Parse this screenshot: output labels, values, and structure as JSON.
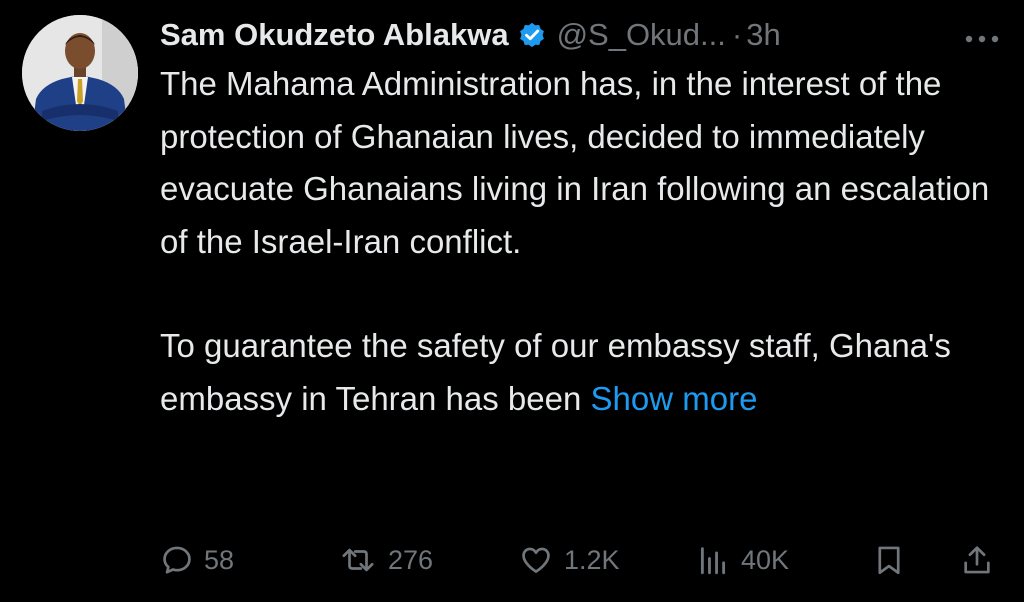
{
  "tweet": {
    "author": {
      "display_name": "Sam Okudzeto Ablakwa",
      "verified_icon": "verified-badge-icon",
      "handle": "@S_Okud...",
      "separator": "·",
      "time": "3h"
    },
    "more_options_icon": "more-horizontal-icon",
    "paragraphs": [
      "The Mahama Administration has, in the interest of the protection of Ghanaian lives, decided to immediately evacuate Ghanaians living in Iran following an escalation of the Israel-Iran conflict.",
      "To guarantee the safety of our embassy staff, Ghana's embassy in Tehran has been"
    ],
    "show_more_label": "Show more",
    "actions": {
      "replies": "58",
      "reposts": "276",
      "likes": "1.2K",
      "views": "40K"
    }
  },
  "colors": {
    "background": "#000000",
    "text": "#e7e9ea",
    "secondary": "#71767b",
    "accent": "#1d9bf0"
  }
}
